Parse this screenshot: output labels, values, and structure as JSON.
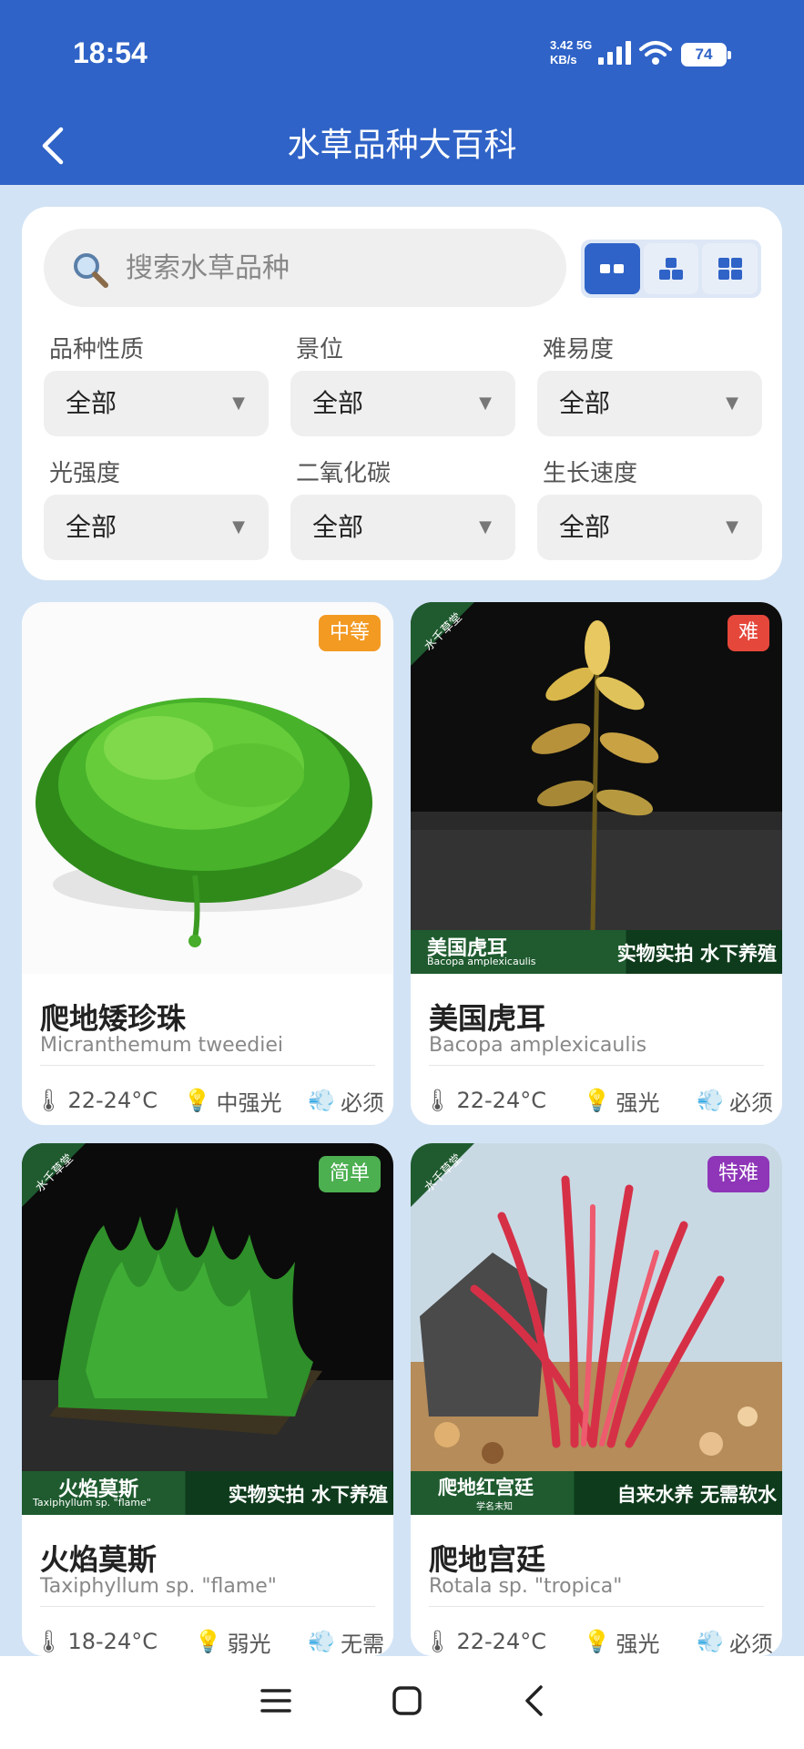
{
  "status": {
    "time": "18:54",
    "net_speed": "3.42",
    "net_unit": "KB/s",
    "net_type": "5G",
    "battery": "74"
  },
  "header": {
    "title": "水草品种大百科",
    "back_icon": "chevron-left-icon"
  },
  "search": {
    "placeholder": "搜索水草品种"
  },
  "view_modes": [
    "two-column-icon",
    "stacked-icon",
    "grid-icon"
  ],
  "filters": [
    {
      "label": "品种性质",
      "value": "全部"
    },
    {
      "label": "景位",
      "value": "全部"
    },
    {
      "label": "难易度",
      "value": "全部"
    },
    {
      "label": "光强度",
      "value": "全部"
    },
    {
      "label": "二氧化碳",
      "value": "全部"
    },
    {
      "label": "生长速度",
      "value": "全部"
    }
  ],
  "plants": [
    {
      "name": "爬地矮珍珠",
      "scientific": "Micranthemum tweediei",
      "difficulty": "中等",
      "badge_color": "#f39a23",
      "temp": "22-24°C",
      "light": "中强光",
      "co2": "必须",
      "strip": null
    },
    {
      "name": "美国虎耳",
      "scientific": "Bacopa amplexicaulis",
      "difficulty": "难",
      "badge_color": "#e5473b",
      "temp": "22-24°C",
      "light": "强光",
      "co2": "必须",
      "strip": {
        "title": "美国虎耳",
        "sub": "Bacopa amplexicaulis",
        "right": "实物实拍  水下养殖"
      }
    },
    {
      "name": "火焰莫斯",
      "scientific": "Taxiphyllum sp. \"flame\"",
      "difficulty": "简单",
      "badge_color": "#4caf50",
      "temp": "18-24°C",
      "light": "弱光",
      "co2": "无需",
      "strip": {
        "title": "火焰莫斯",
        "sub": "Taxiphyllum sp. \"flame\"",
        "right": "实物实拍  水下养殖"
      }
    },
    {
      "name": "爬地宫廷",
      "scientific": "Rotala sp. \"tropica\"",
      "difficulty": "特难",
      "badge_color": "#8e35b8",
      "temp": "22-24°C",
      "light": "强光",
      "co2": "必须",
      "strip": {
        "title": "爬地红宫廷",
        "sub": "学名未知",
        "right": "自来水养  无需软水"
      }
    }
  ],
  "watermark": "水千草堂",
  "nav": [
    "menu-icon",
    "home-icon",
    "back-icon"
  ]
}
